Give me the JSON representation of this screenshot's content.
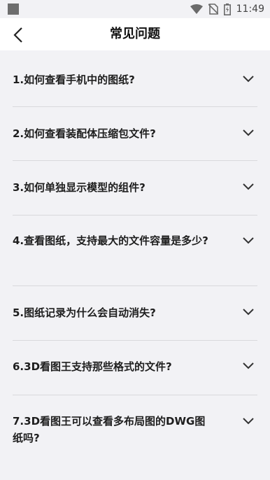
{
  "status_bar": {
    "time": "11:49",
    "icons": [
      "wifi-icon",
      "no-sim-icon",
      "battery-icon"
    ]
  },
  "header": {
    "title": "常见问题",
    "back_icon": "chevron-left-icon"
  },
  "faq": {
    "items": [
      {
        "question": "1.如何查看手机中的图纸?"
      },
      {
        "question": "2.如何查看装配体压缩包文件?"
      },
      {
        "question": "3.如何单独显示模型的组件?"
      },
      {
        "question": "4.查看图纸，支持最大的文件容量是多少?"
      },
      {
        "question": "5.图纸记录为什么会自动消失?"
      },
      {
        "question": "6.3D看图王支持那些格式的文件?"
      },
      {
        "question": "7.3D看图王可以查看多布局图的DWG图纸吗?"
      }
    ],
    "expand_icon": "chevron-down-icon"
  },
  "colors": {
    "background": "#f2f2f5",
    "header": "#ffffff",
    "divider": "#d9d9dc",
    "text": "#1e1e1e"
  }
}
